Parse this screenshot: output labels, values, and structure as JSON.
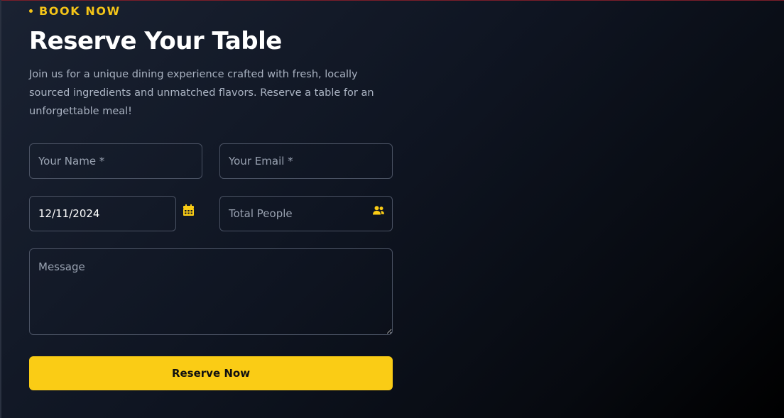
{
  "section": {
    "eyebrow": "BOOK NOW",
    "title": "Reserve Your Table",
    "description": "Join us for a unique dining experience crafted with fresh, locally sourced ingredients and unmatched flavors. Reserve a table for an unforgettable meal!"
  },
  "form": {
    "name": {
      "placeholder": "Your Name *",
      "value": ""
    },
    "email": {
      "placeholder": "Your Email *",
      "value": ""
    },
    "date": {
      "value": "12/11/2024",
      "icon": "calendar-icon"
    },
    "people": {
      "placeholder": "Total People",
      "value": "",
      "icon": "people-icon"
    },
    "message": {
      "placeholder": "Message",
      "value": ""
    },
    "submit_label": "Reserve Now"
  },
  "colors": {
    "accent": "#facc15",
    "background": "#0f1522",
    "border": "#4a5263",
    "text": "#ffffff",
    "muted": "#aab3c2"
  }
}
